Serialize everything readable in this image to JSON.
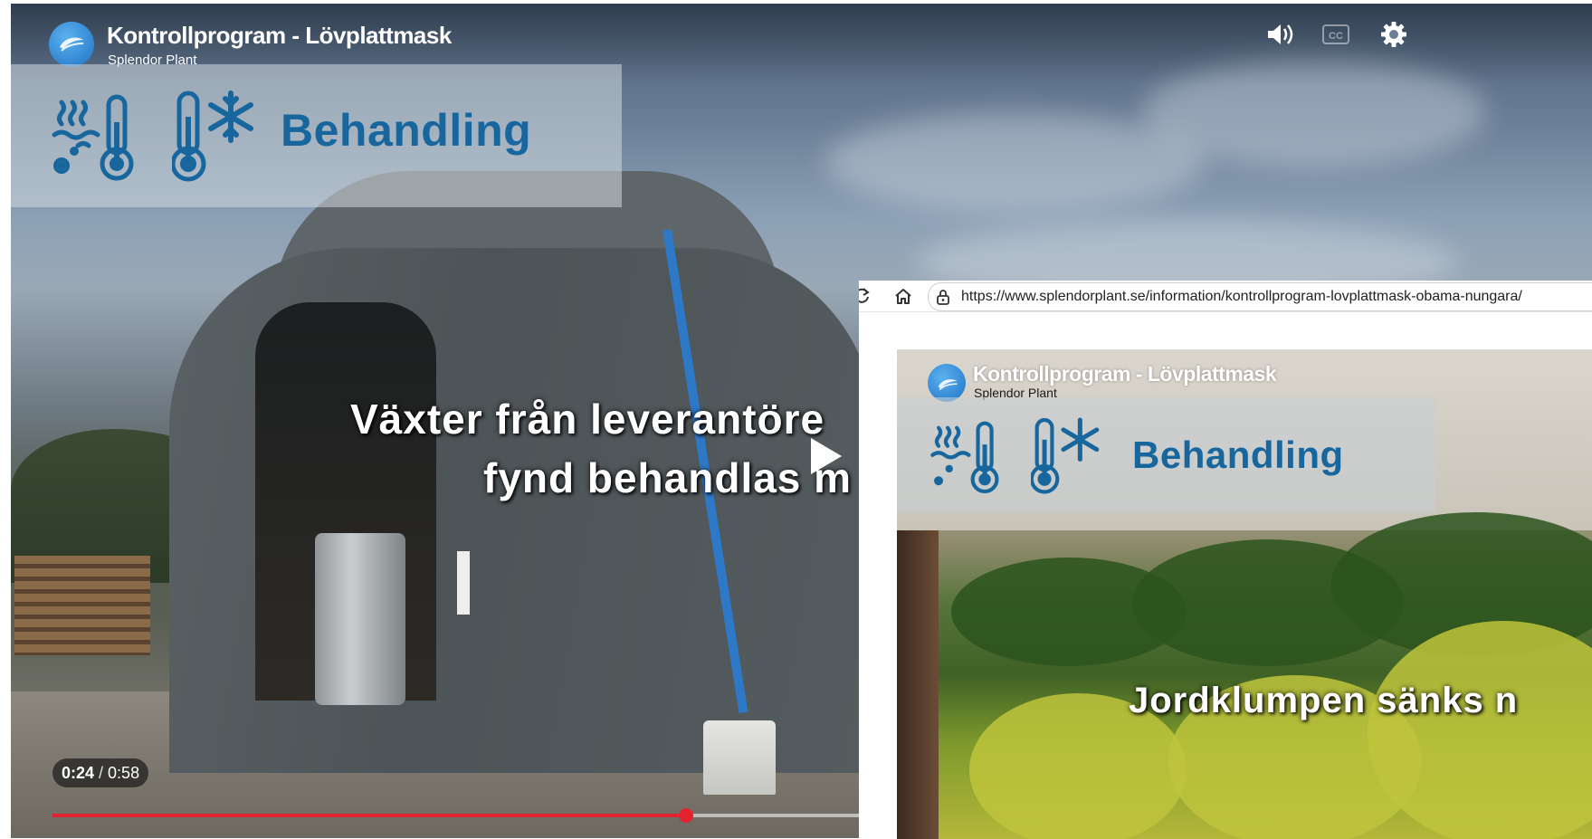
{
  "player": {
    "title": "Kontrollprogram - Lövplattmask",
    "channel": "Splendor Plant",
    "banner_label": "Behandling",
    "subtitle_line1": "Växter från leverantöre",
    "subtitle_line2": "fynd behandlas m",
    "current_time": "0:24",
    "separator": "/",
    "duration": "0:58",
    "progress_fraction": 0.414,
    "icons": [
      "volume-icon",
      "closed-captions-icon",
      "settings-icon",
      "play-icon"
    ]
  },
  "browser": {
    "url": "https://www.splendorplant.se/information/kontrollprogram-lovplattmask-obama-nungara/",
    "embedded_video": {
      "title": "Kontrollprogram - Lövplattmask",
      "channel": "Splendor Plant",
      "banner_label": "Behandling",
      "subtitle": "Jordklumpen sänks n"
    }
  },
  "colors": {
    "accent_red": "#e5232f",
    "banner_blue": "#17679e",
    "logo_blue": "#1e72c6"
  }
}
